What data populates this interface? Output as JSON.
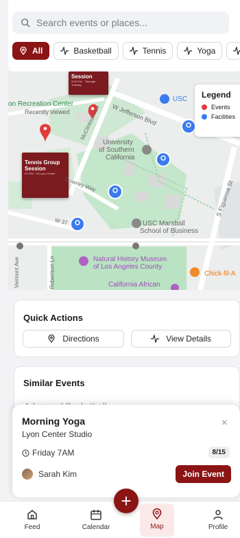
{
  "search": {
    "placeholder": "Search events or places..."
  },
  "filters": [
    {
      "label": "All",
      "icon": "location-pin-icon",
      "active": true
    },
    {
      "label": "Basketball",
      "icon": "activity-icon"
    },
    {
      "label": "Tennis",
      "icon": "activity-icon"
    },
    {
      "label": "Yoga",
      "icon": "activity-icon"
    }
  ],
  "map": {
    "legend": {
      "title": "Legend",
      "items": [
        {
          "label": "Events",
          "color": "#e33a3a"
        },
        {
          "label": "Facilities",
          "color": "#3b7bf0"
        }
      ]
    },
    "labels": {
      "rec_center": "on Recreation Center",
      "recently_viewed": "Recently viewed",
      "usc": "USC",
      "jefferson": "W Jefferson Blvd",
      "mcclintock": "McClintock Ave",
      "university": "University",
      "of_southern": "of Southern",
      "california": "California",
      "downey": "Downey Way",
      "w37": "W 37",
      "figueroa": "S Figueroa St",
      "marshall1": "USC Marshall",
      "marshall2": "School of Business",
      "museum1": "Natural History Museum",
      "museum2": "of Los Angeles County",
      "california_african": "California African",
      "chick": "Chick-fil-A",
      "vermont": "Vermont Ave",
      "robertson": "Robertson Ln"
    },
    "event_cards": [
      {
        "title": "Session",
        "sub": "3:00 P.M. · Strength Training"
      },
      {
        "title": "Tennis Group Session",
        "sub": "4:0 PM · 2/4 Lyon Center"
      }
    ]
  },
  "quick_actions": {
    "title": "Quick Actions",
    "directions": "Directions",
    "view_details": "View Details"
  },
  "similar_events": {
    "title": "Similar Events",
    "peek": "Advanced Basketball"
  },
  "event": {
    "title": "Morning Yoga",
    "location": "Lyon Center Studio",
    "time": "Friday 7AM",
    "capacity": "8/15",
    "host": "Sarah Kim",
    "join": "Join Event",
    "close": "×"
  },
  "nav": {
    "feed": "Feed",
    "calendar": "Calendar",
    "map": "Map",
    "profile": "Profile",
    "fab": "+"
  },
  "colors": {
    "accent": "#8b1414",
    "event_pin": "#e33a3a",
    "facility_pin": "#3b7bf0"
  }
}
